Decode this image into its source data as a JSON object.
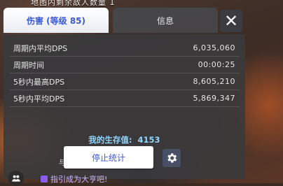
{
  "hud": {
    "enemy_count_label": "地图内剩余敌人数量 1"
  },
  "tabs": [
    {
      "label": "伤害 (等级 85)",
      "active": true
    },
    {
      "label": "信息",
      "active": false
    }
  ],
  "close_icon": "close-icon",
  "stats": [
    {
      "label": "周期内平均DPS",
      "value": "6,035,060"
    },
    {
      "label": "周期时间",
      "value": "00:00:25"
    },
    {
      "label": "5秒内最高DPS",
      "value": "8,605,210"
    },
    {
      "label": "5秒内平均DPS",
      "value": "5,869,347"
    }
  ],
  "survival": {
    "label": "我的生存值:",
    "value": "4153"
  },
  "buttons": {
    "stop_label": "停止统计"
  },
  "chat": {
    "hint": "与",
    "message": "指引成为大亨吧!"
  },
  "colors": {
    "accent": "#3d5ad6",
    "survival": "#8fd7ff",
    "panel": "#3a3a3c"
  }
}
